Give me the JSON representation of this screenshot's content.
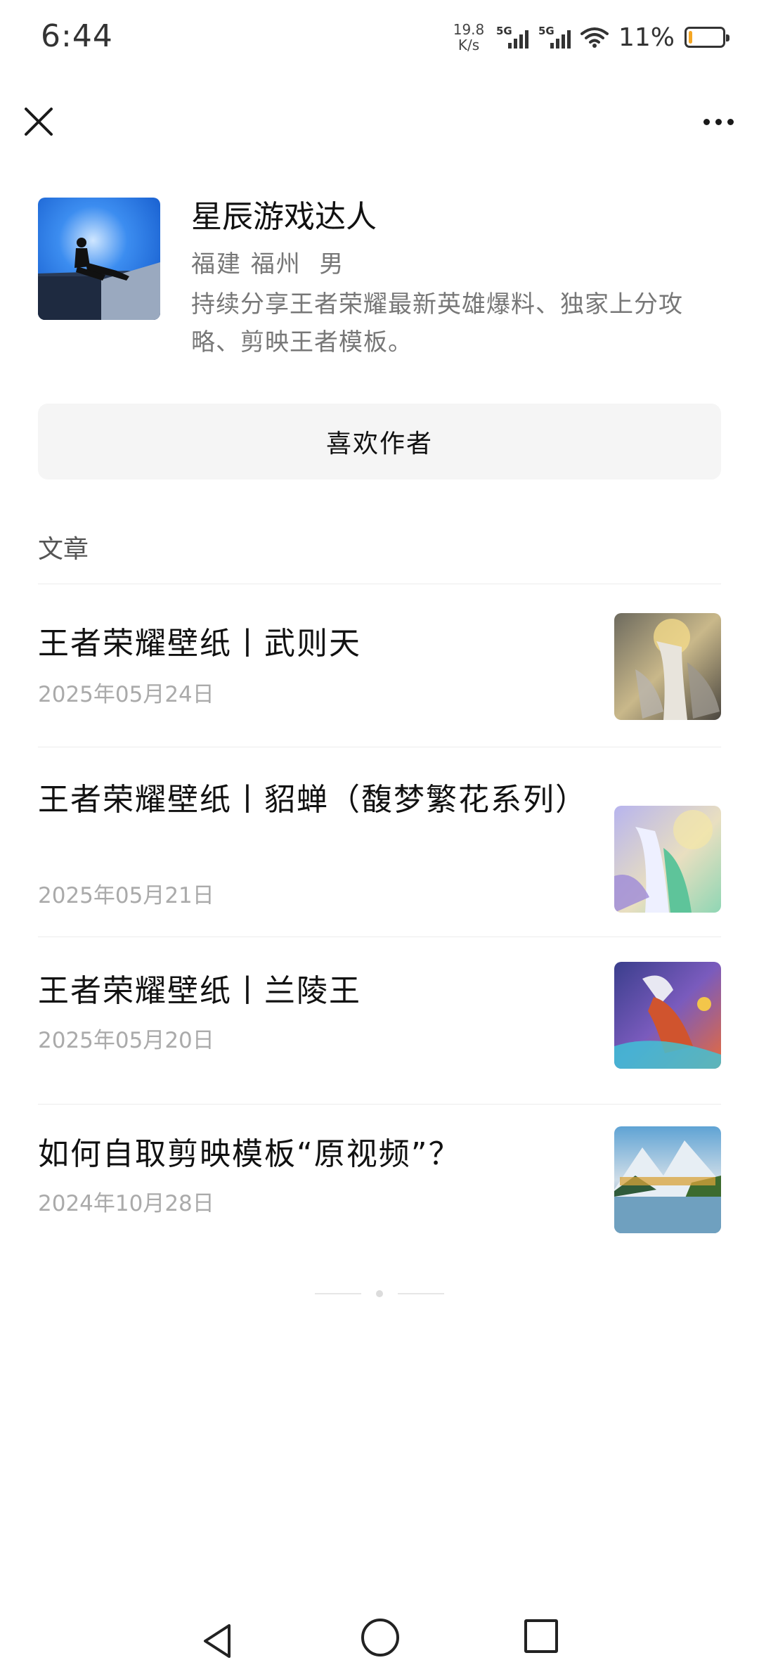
{
  "status_bar": {
    "time": "6:44",
    "net_speed_value": "19.8",
    "net_speed_unit": "K/s",
    "sim1_tag": "5G",
    "sim2_tag": "5G",
    "battery_percent": "11%",
    "battery_level": 0.11,
    "battery_color": "#f5a623"
  },
  "top_nav": {
    "close_icon": "close-icon",
    "more_icon": "more-horizontal-icon"
  },
  "profile": {
    "name": "星辰游戏达人",
    "location": "福建 福州  男",
    "bio": "持续分享王者荣耀最新英雄爆料、独家上分攻略、剪映王者模板。"
  },
  "like_button": {
    "label": "喜欢作者"
  },
  "section": {
    "label": "文章"
  },
  "articles": [
    {
      "title": "王者荣耀壁纸丨武则天",
      "date": "2025年05月24日"
    },
    {
      "title": "王者荣耀壁纸丨貂蝉（馥梦繁花系列）",
      "date": "2025年05月21日"
    },
    {
      "title": "王者荣耀壁纸丨兰陵王",
      "date": "2025年05月20日"
    },
    {
      "title": "如何自取剪映模板“原视频”？",
      "date": "2024年10月28日"
    }
  ],
  "nav_bar": {
    "back_icon": "back-triangle-icon",
    "home_icon": "home-circle-icon",
    "recent_icon": "recent-square-icon"
  }
}
